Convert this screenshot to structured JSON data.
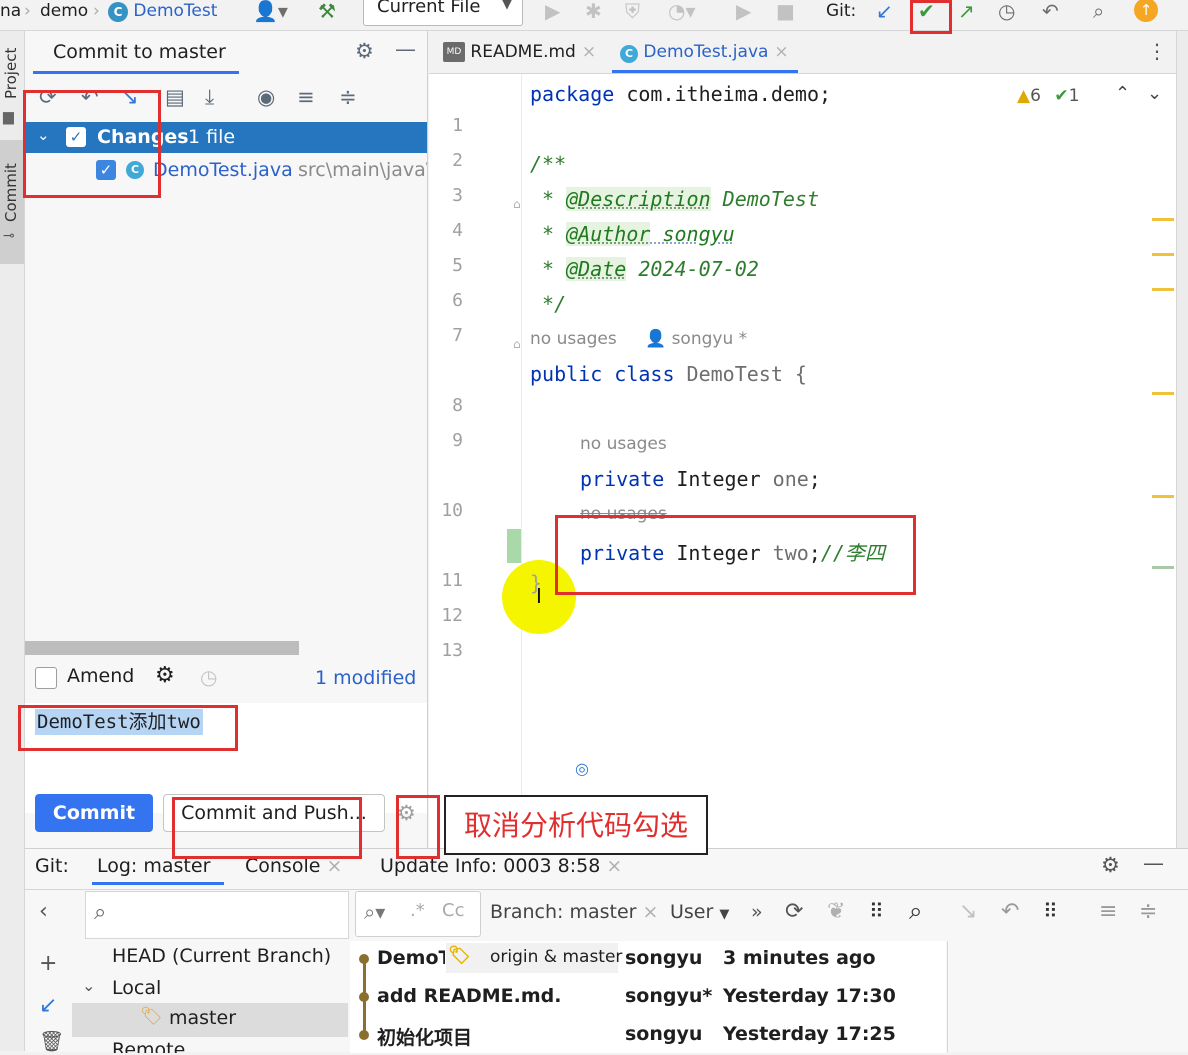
{
  "breadcrumb": {
    "project_cut": "na",
    "module": "demo",
    "file": "DemoTest"
  },
  "toolbar": {
    "run_config": "Current File",
    "git_label": "Git:"
  },
  "leftstrip": {
    "project_label": "Project",
    "commit_label": "Commit"
  },
  "commit_panel": {
    "title": "Commit to master",
    "changes_label": "Changes",
    "changes_count": "1 file",
    "file_name": "DemoTest.java",
    "file_path": "src\\main\\java\\",
    "amend_label": "Amend",
    "modified_label": "1 modified",
    "message": "DemoTest添加two",
    "commit_button": "Commit",
    "commit_push_button": "Commit and Push..."
  },
  "editor": {
    "tabs": [
      {
        "label": "README.md"
      },
      {
        "label": "DemoTest.java"
      }
    ],
    "badge_md": "MD",
    "warnings_count": "6",
    "checks_count": "1",
    "line_numbers": [
      "1",
      "2",
      "3",
      "4",
      "5",
      "6",
      "7",
      "8",
      "9",
      "10",
      "11",
      "12",
      "13"
    ],
    "code": {
      "l1_kw": "package",
      "l1_rest": " com.itheima.demo;",
      "l3": "/**",
      "l4_star": " * ",
      "l4_tag": "@Description",
      "l4_val": " DemoTest",
      "l5_star": " * ",
      "l5_tag": "@Author",
      "l5_val": " songyu",
      "l6_star": " * ",
      "l6_tag": "@Date",
      "l6_val": " 2024-07-02",
      "l7": " */",
      "hint_usages_class": "no usages",
      "hint_author": "songyu *",
      "l8_kw": "public class",
      "l8_rest": " DemoTest {",
      "hint_usages_one": "no usages",
      "l10_kw": "private",
      "l10_type": " Integer ",
      "l10_field": "one",
      "l10_end": ";",
      "hint_usages_two": "no usages",
      "l11_kw": "private",
      "l11_type": " Integer ",
      "l11_field": "two",
      "l11_end": ";",
      "l11_comment": "//李四",
      "l12": "}"
    }
  },
  "git_panel": {
    "git_label": "Git:",
    "tabs": [
      {
        "label": "Log: master"
      },
      {
        "label": "Console"
      },
      {
        "label": "Update Info: 0003 8:58"
      }
    ],
    "branch_filter": "Branch: master",
    "user_filter": "User",
    "tree": {
      "head": "HEAD (Current Branch)",
      "local": "Local",
      "master": "master",
      "remote": "Remote"
    },
    "commits": [
      {
        "message": "DemoT",
        "refs": "origin & master",
        "author": "songyu",
        "date": "3 minutes ago"
      },
      {
        "message": "add README.md.",
        "author": "songyu*",
        "date": "Yesterday 17:30"
      },
      {
        "message": "初始化项目",
        "author": "songyu",
        "date": "Yesterday 17:25"
      }
    ]
  },
  "annotation": {
    "callout_text": "取消分析代码勾选"
  }
}
